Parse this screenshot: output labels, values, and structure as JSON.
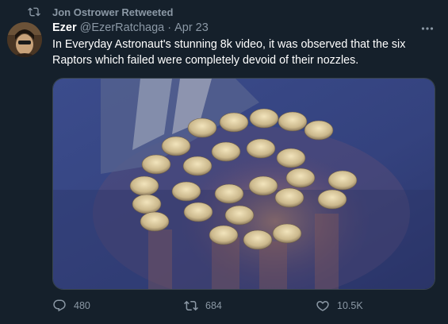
{
  "retweet": {
    "label": "Jon Ostrower Retweeted",
    "icon": "retweet-icon"
  },
  "tweet": {
    "author_name": "Ezer",
    "author_handle": "@EzerRatchaga",
    "separator": "·",
    "date": "Apr 23",
    "text": "In Everyday Astronaut's stunning 8k video, it was observed that the six Raptors which failed were completely devoid of their nozzles.",
    "more_icon": "more-icon"
  },
  "media": {
    "icon": "image-rocket-engines"
  },
  "actions": {
    "reply_count": "480",
    "retweet_count": "684",
    "like_count": "10.5K"
  },
  "colors": {
    "background": "#15202b",
    "secondary_text": "#8b98a5",
    "primary_text": "#ffffff",
    "border": "#38444d"
  }
}
